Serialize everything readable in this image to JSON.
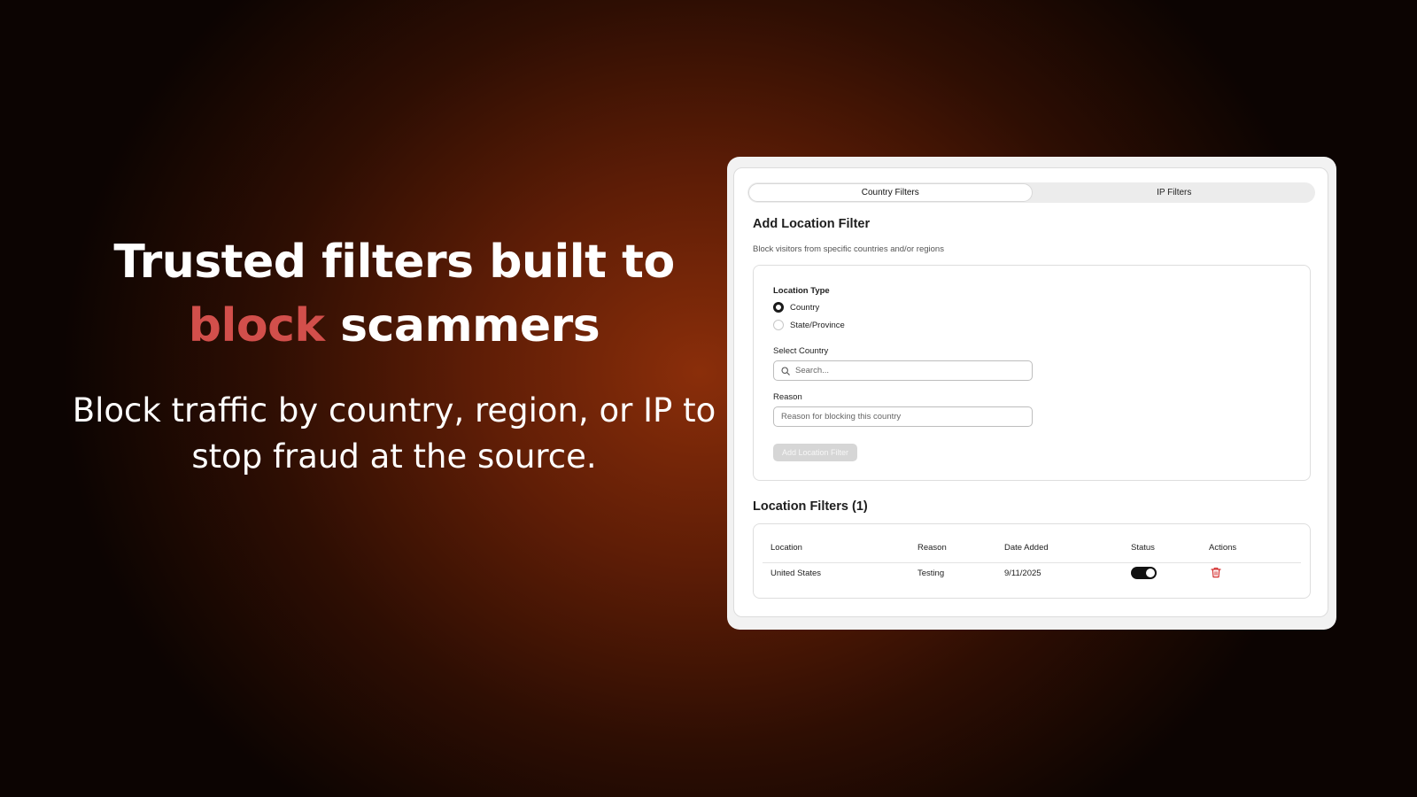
{
  "hero": {
    "title_line1": "Trusted filters built to",
    "title_accent": "block",
    "title_rest": " scammers",
    "subtitle_line1": "Block traffic by country, region, or IP to",
    "subtitle_line2": "stop fraud at the source."
  },
  "tabs": [
    {
      "label": "Country Filters",
      "active": true
    },
    {
      "label": "IP Filters",
      "active": false
    }
  ],
  "add_filter": {
    "title": "Add Location Filter",
    "description": "Block visitors from specific countries and/or regions",
    "location_type_label": "Location Type",
    "options": [
      {
        "label": "Country",
        "checked": true
      },
      {
        "label": "State/Province",
        "checked": false
      }
    ],
    "select_country_label": "Select Country",
    "search_placeholder": "Search...",
    "reason_label": "Reason",
    "reason_placeholder": "Reason for blocking this country",
    "submit_label": "Add Location Filter"
  },
  "filters": {
    "title": "Location Filters (1)",
    "columns": [
      "Location",
      "Reason",
      "Date Added",
      "Status",
      "Actions"
    ],
    "rows": [
      {
        "location": "United States",
        "reason": "Testing",
        "date_added": "9/11/2025",
        "status": true
      }
    ]
  },
  "colors": {
    "accent": "#d24f4b",
    "delete": "#d32f2f",
    "toggle_on": "#111111"
  }
}
